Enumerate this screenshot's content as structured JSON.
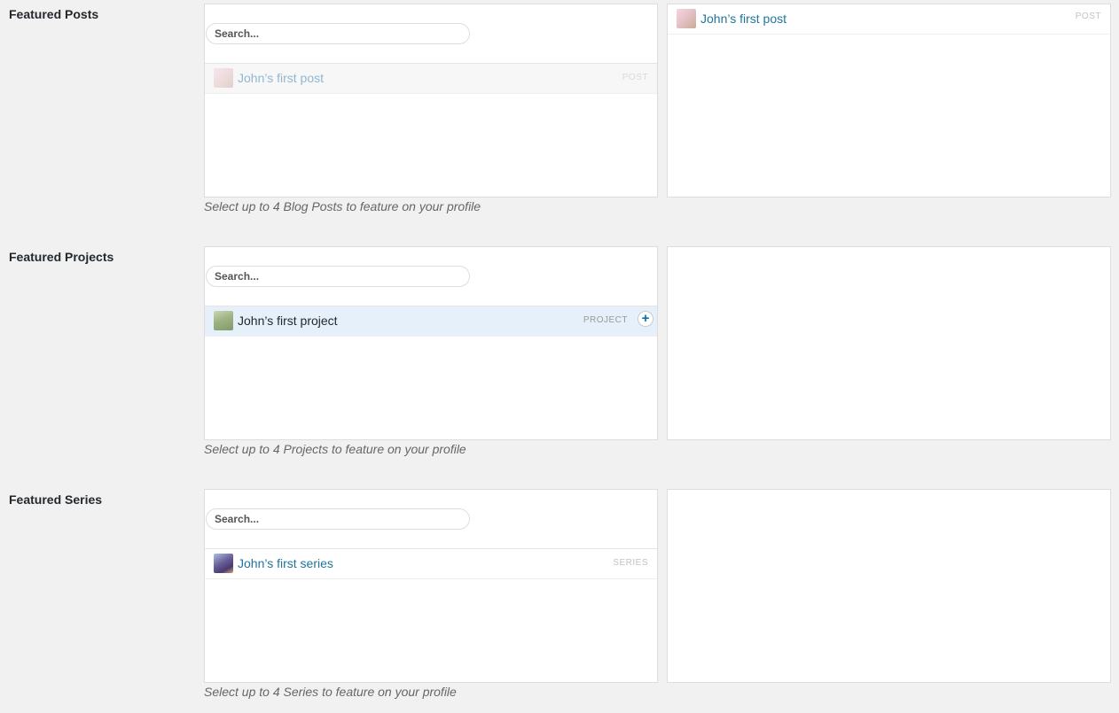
{
  "colors": {
    "page_bg": "#f1f1f1",
    "link": "#21759b",
    "hover_row_bg": "#e5f0fa",
    "add_button": "#0073aa"
  },
  "sections": [
    {
      "title": "Featured Posts",
      "search_placeholder": "Search...",
      "results": [
        {
          "title": "John’s first post",
          "type": "POST",
          "state": "disabled",
          "thumb_icon": "post-thumbnail-icon"
        }
      ],
      "selected": [
        {
          "title": "John’s first post",
          "type": "POST",
          "thumb_icon": "post-thumbnail-icon"
        }
      ],
      "description": "Select up to 4 Blog Posts to feature on your profile"
    },
    {
      "title": "Featured Projects",
      "search_placeholder": "Search...",
      "results": [
        {
          "title": "John’s first project",
          "type": "PROJECT",
          "state": "hover",
          "thumb_icon": "project-thumbnail-icon",
          "add_symbol": "+"
        }
      ],
      "selected": [],
      "description": "Select up to 4 Projects to feature on your profile"
    },
    {
      "title": "Featured Series",
      "search_placeholder": "Search...",
      "results": [
        {
          "title": "John’s first series",
          "type": "SERIES",
          "state": "normal",
          "thumb_icon": "series-thumbnail-icon"
        }
      ],
      "selected": [],
      "description": "Select up to 4 Series to feature on your profile"
    }
  ]
}
